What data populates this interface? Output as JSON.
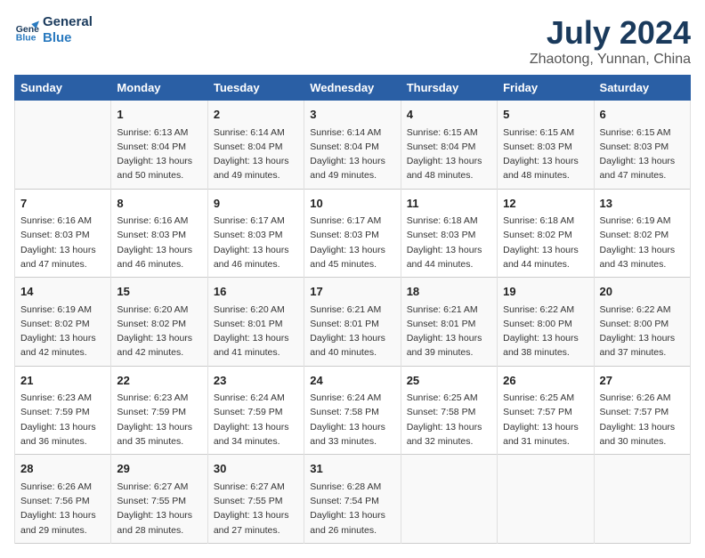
{
  "logo": {
    "line1": "General",
    "line2": "Blue"
  },
  "title": "July 2024",
  "subtitle": "Zhaotong, Yunnan, China",
  "days_header": [
    "Sunday",
    "Monday",
    "Tuesday",
    "Wednesday",
    "Thursday",
    "Friday",
    "Saturday"
  ],
  "weeks": [
    [
      {
        "day": "",
        "info": ""
      },
      {
        "day": "1",
        "info": "Sunrise: 6:13 AM\nSunset: 8:04 PM\nDaylight: 13 hours\nand 50 minutes."
      },
      {
        "day": "2",
        "info": "Sunrise: 6:14 AM\nSunset: 8:04 PM\nDaylight: 13 hours\nand 49 minutes."
      },
      {
        "day": "3",
        "info": "Sunrise: 6:14 AM\nSunset: 8:04 PM\nDaylight: 13 hours\nand 49 minutes."
      },
      {
        "day": "4",
        "info": "Sunrise: 6:15 AM\nSunset: 8:04 PM\nDaylight: 13 hours\nand 48 minutes."
      },
      {
        "day": "5",
        "info": "Sunrise: 6:15 AM\nSunset: 8:03 PM\nDaylight: 13 hours\nand 48 minutes."
      },
      {
        "day": "6",
        "info": "Sunrise: 6:15 AM\nSunset: 8:03 PM\nDaylight: 13 hours\nand 47 minutes."
      }
    ],
    [
      {
        "day": "7",
        "info": "Sunrise: 6:16 AM\nSunset: 8:03 PM\nDaylight: 13 hours\nand 47 minutes."
      },
      {
        "day": "8",
        "info": "Sunrise: 6:16 AM\nSunset: 8:03 PM\nDaylight: 13 hours\nand 46 minutes."
      },
      {
        "day": "9",
        "info": "Sunrise: 6:17 AM\nSunset: 8:03 PM\nDaylight: 13 hours\nand 46 minutes."
      },
      {
        "day": "10",
        "info": "Sunrise: 6:17 AM\nSunset: 8:03 PM\nDaylight: 13 hours\nand 45 minutes."
      },
      {
        "day": "11",
        "info": "Sunrise: 6:18 AM\nSunset: 8:03 PM\nDaylight: 13 hours\nand 44 minutes."
      },
      {
        "day": "12",
        "info": "Sunrise: 6:18 AM\nSunset: 8:02 PM\nDaylight: 13 hours\nand 44 minutes."
      },
      {
        "day": "13",
        "info": "Sunrise: 6:19 AM\nSunset: 8:02 PM\nDaylight: 13 hours\nand 43 minutes."
      }
    ],
    [
      {
        "day": "14",
        "info": "Sunrise: 6:19 AM\nSunset: 8:02 PM\nDaylight: 13 hours\nand 42 minutes."
      },
      {
        "day": "15",
        "info": "Sunrise: 6:20 AM\nSunset: 8:02 PM\nDaylight: 13 hours\nand 42 minutes."
      },
      {
        "day": "16",
        "info": "Sunrise: 6:20 AM\nSunset: 8:01 PM\nDaylight: 13 hours\nand 41 minutes."
      },
      {
        "day": "17",
        "info": "Sunrise: 6:21 AM\nSunset: 8:01 PM\nDaylight: 13 hours\nand 40 minutes."
      },
      {
        "day": "18",
        "info": "Sunrise: 6:21 AM\nSunset: 8:01 PM\nDaylight: 13 hours\nand 39 minutes."
      },
      {
        "day": "19",
        "info": "Sunrise: 6:22 AM\nSunset: 8:00 PM\nDaylight: 13 hours\nand 38 minutes."
      },
      {
        "day": "20",
        "info": "Sunrise: 6:22 AM\nSunset: 8:00 PM\nDaylight: 13 hours\nand 37 minutes."
      }
    ],
    [
      {
        "day": "21",
        "info": "Sunrise: 6:23 AM\nSunset: 7:59 PM\nDaylight: 13 hours\nand 36 minutes."
      },
      {
        "day": "22",
        "info": "Sunrise: 6:23 AM\nSunset: 7:59 PM\nDaylight: 13 hours\nand 35 minutes."
      },
      {
        "day": "23",
        "info": "Sunrise: 6:24 AM\nSunset: 7:59 PM\nDaylight: 13 hours\nand 34 minutes."
      },
      {
        "day": "24",
        "info": "Sunrise: 6:24 AM\nSunset: 7:58 PM\nDaylight: 13 hours\nand 33 minutes."
      },
      {
        "day": "25",
        "info": "Sunrise: 6:25 AM\nSunset: 7:58 PM\nDaylight: 13 hours\nand 32 minutes."
      },
      {
        "day": "26",
        "info": "Sunrise: 6:25 AM\nSunset: 7:57 PM\nDaylight: 13 hours\nand 31 minutes."
      },
      {
        "day": "27",
        "info": "Sunrise: 6:26 AM\nSunset: 7:57 PM\nDaylight: 13 hours\nand 30 minutes."
      }
    ],
    [
      {
        "day": "28",
        "info": "Sunrise: 6:26 AM\nSunset: 7:56 PM\nDaylight: 13 hours\nand 29 minutes."
      },
      {
        "day": "29",
        "info": "Sunrise: 6:27 AM\nSunset: 7:55 PM\nDaylight: 13 hours\nand 28 minutes."
      },
      {
        "day": "30",
        "info": "Sunrise: 6:27 AM\nSunset: 7:55 PM\nDaylight: 13 hours\nand 27 minutes."
      },
      {
        "day": "31",
        "info": "Sunrise: 6:28 AM\nSunset: 7:54 PM\nDaylight: 13 hours\nand 26 minutes."
      },
      {
        "day": "",
        "info": ""
      },
      {
        "day": "",
        "info": ""
      },
      {
        "day": "",
        "info": ""
      }
    ]
  ]
}
